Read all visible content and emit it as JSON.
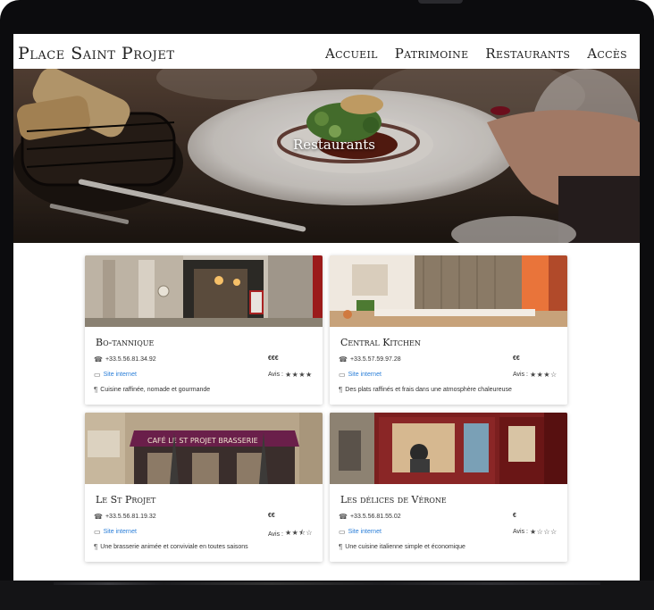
{
  "brand": "Place Saint Projet",
  "nav": [
    "Accueil",
    "Patrimoine",
    "Restaurants",
    "Accès"
  ],
  "hero": {
    "title": "Restaurants"
  },
  "restaurants": [
    {
      "name": "Bo-tannique",
      "phone": "+33.5.56.81.34.92",
      "price": "€€€",
      "website": "Site internet",
      "reviews_label": "Avis :",
      "rating": 4,
      "description": "Cuisine raffinée, nomade et gourmande"
    },
    {
      "name": "Central Kitchen",
      "phone": "+33.5.57.59.97.28",
      "price": "€€",
      "website": "Site internet",
      "reviews_label": "Avis :",
      "rating": 3,
      "description": "Des plats raffinés et frais dans une atmosphère chaleureuse"
    },
    {
      "name": "Le St Projet",
      "phone": "+33.5.56.81.19.32",
      "price": "€€",
      "website": "Site internet",
      "reviews_label": "Avis :",
      "rating": 2.5,
      "description": "Une brasserie animée et conviviale en toutes saisons"
    },
    {
      "name": "Les délices de Vérone",
      "phone": "+33.5.56.81.55.02",
      "price": "€",
      "website": "Site internet",
      "reviews_label": "Avis :",
      "rating": 1,
      "description": "Une cuisine italienne simple et économique"
    }
  ],
  "photo_signs": {
    "cafe_awning": "CAFÉ LE ST PROJET BRASSERIE"
  },
  "colors": {
    "link": "#2a7ed8",
    "frame": "#0c0c0e"
  }
}
